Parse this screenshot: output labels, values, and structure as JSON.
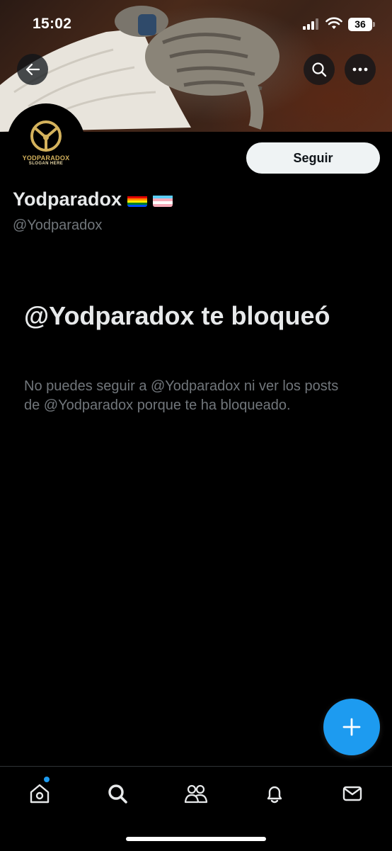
{
  "status_bar": {
    "time": "15:02",
    "battery": "36"
  },
  "header": {
    "back_icon": "arrow-left-icon",
    "search_icon": "search-icon",
    "more_icon": "more-horizontal-icon"
  },
  "avatar": {
    "brand": "YODPARADOX",
    "slogan": "SLOGAN HERE"
  },
  "profile": {
    "display_name": "Yodparadox",
    "flags": [
      "rainbow-flag-icon",
      "transgender-flag-icon"
    ],
    "handle": "@Yodparadox",
    "follow_label": "Seguir"
  },
  "blocked": {
    "title": "@Yodparadox te bloqueó",
    "description": "No puedes seguir a @Yodparadox ni ver los posts de @Yodparadox porque te ha bloqueado."
  },
  "fab": {
    "icon": "plus-icon"
  },
  "tabbar": {
    "items": [
      "home-icon",
      "search-icon",
      "communities-icon",
      "notifications-icon",
      "messages-icon"
    ]
  },
  "colors": {
    "background": "#000000",
    "accent": "#1d9bf0",
    "text_primary": "#e7e9ea",
    "text_secondary": "#71767b",
    "follow_button": "#eff3f4"
  }
}
